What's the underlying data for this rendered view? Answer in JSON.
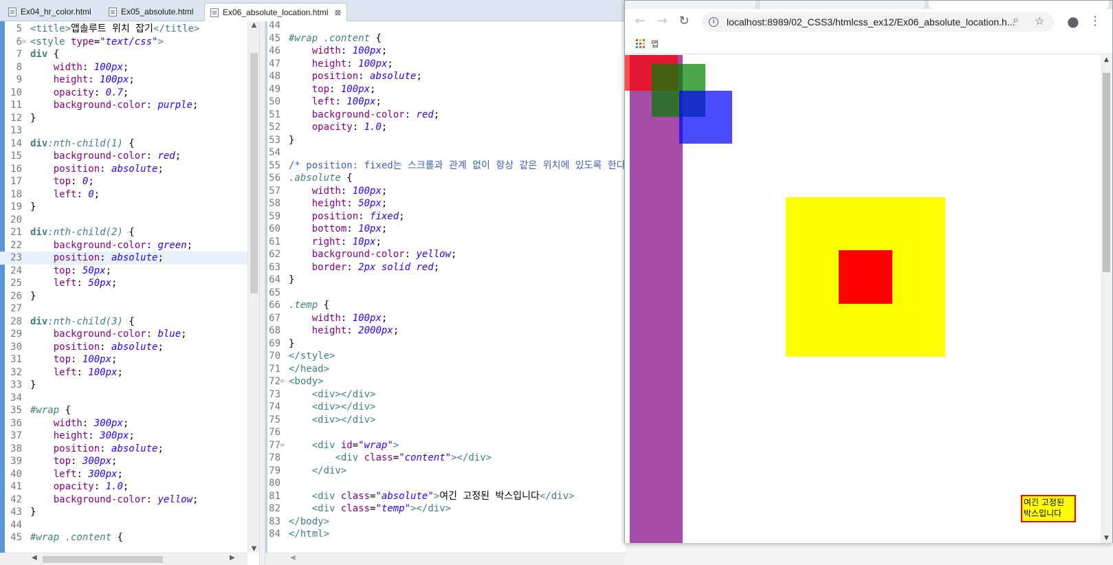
{
  "editor": {
    "tabs": [
      {
        "label": "Ex04_hr_color.html",
        "active": false
      },
      {
        "label": "Ex05_absolute.html",
        "active": false
      },
      {
        "label": "Ex06_absolute_location.html",
        "active": true,
        "close": "⊠"
      }
    ],
    "left_pane": {
      "lines": [
        {
          "n": "5",
          "html": "<span class='t'>&lt;title&gt;</span>앱솔루트 위치 잡기<span class='t'>&lt;/title&gt;</span>"
        },
        {
          "n": "6",
          "fold": true,
          "html": "<span class='t'>&lt;style</span> <span class='a'>type</span>=<span class='v'>\"text/css\"</span><span class='t'>&gt;</span>"
        },
        {
          "n": "7",
          "html": "<span class='k'>div</span> {"
        },
        {
          "n": "8",
          "html": "    <span class='p'>width</span>: <span class='v'>100px</span>;"
        },
        {
          "n": "9",
          "html": "    <span class='p'>height</span>: <span class='v'>100px</span>;"
        },
        {
          "n": "10",
          "html": "    <span class='p'>opacity</span>: <span class='v'>0.7</span>;"
        },
        {
          "n": "11",
          "html": "    <span class='p'>background-color</span>: <span class='v'>purple</span>;"
        },
        {
          "n": "12",
          "html": "}"
        },
        {
          "n": "13",
          "html": ""
        },
        {
          "n": "14",
          "html": "<span class='k'>div</span><span class='i'>:nth-child(1)</span> {"
        },
        {
          "n": "15",
          "html": "    <span class='p'>background-color</span>: <span class='v'>red</span>;"
        },
        {
          "n": "16",
          "html": "    <span class='p'>position</span>: <span class='v'>absolute</span>;"
        },
        {
          "n": "17",
          "html": "    <span class='p'>top</span>: <span class='v'>0</span>;"
        },
        {
          "n": "18",
          "html": "    <span class='p'>left</span>: <span class='v'>0</span>;"
        },
        {
          "n": "19",
          "html": "}"
        },
        {
          "n": "20",
          "html": ""
        },
        {
          "n": "21",
          "html": "<span class='k'>div</span><span class='i'>:nth-child(2)</span> {"
        },
        {
          "n": "22",
          "html": "    <span class='p'>background-color</span>: <span class='v'>green</span>;"
        },
        {
          "n": "23",
          "hl": true,
          "html": "    <span class='p'>position</span>: <span class='v'>absolute</span>;"
        },
        {
          "n": "24",
          "html": "    <span class='p'>top</span>: <span class='v'>50px</span>;"
        },
        {
          "n": "25",
          "html": "    <span class='p'>left</span>: <span class='v'>50px</span>;"
        },
        {
          "n": "26",
          "html": "}"
        },
        {
          "n": "27",
          "html": ""
        },
        {
          "n": "28",
          "html": "<span class='k'>div</span><span class='i'>:nth-child(3)</span> {"
        },
        {
          "n": "29",
          "html": "    <span class='p'>background-color</span>: <span class='v'>blue</span>;"
        },
        {
          "n": "30",
          "html": "    <span class='p'>position</span>: <span class='v'>absolute</span>;"
        },
        {
          "n": "31",
          "html": "    <span class='p'>top</span>: <span class='v'>100px</span>;"
        },
        {
          "n": "32",
          "html": "    <span class='p'>left</span>: <span class='v'>100px</span>;"
        },
        {
          "n": "33",
          "html": "}"
        },
        {
          "n": "34",
          "html": ""
        },
        {
          "n": "35",
          "html": "<span class='i'>#wrap</span> {"
        },
        {
          "n": "36",
          "html": "    <span class='p'>width</span>: <span class='v'>300px</span>;"
        },
        {
          "n": "37",
          "html": "    <span class='p'>height</span>: <span class='v'>300px</span>;"
        },
        {
          "n": "38",
          "html": "    <span class='p'>position</span>: <span class='v'>absolute</span>;"
        },
        {
          "n": "39",
          "html": "    <span class='p'>top</span>: <span class='v'>300px</span>;"
        },
        {
          "n": "40",
          "html": "    <span class='p'>left</span>: <span class='v'>300px</span>;"
        },
        {
          "n": "41",
          "html": "    <span class='p'>opacity</span>: <span class='v'>1.0</span>;"
        },
        {
          "n": "42",
          "html": "    <span class='p'>background-color</span>: <span class='v'>yellow</span>;"
        },
        {
          "n": "43",
          "html": "}"
        },
        {
          "n": "44",
          "html": ""
        },
        {
          "n": "45",
          "html": "<span class='i'>#wrap .content</span> {"
        }
      ]
    },
    "middle_pane": {
      "lines": [
        {
          "n": "44",
          "html": ""
        },
        {
          "n": "45",
          "html": "<span class='i'>#wrap .content</span> {"
        },
        {
          "n": "46",
          "html": "    <span class='p'>width</span>: <span class='v'>100px</span>;"
        },
        {
          "n": "47",
          "html": "    <span class='p'>height</span>: <span class='v'>100px</span>;"
        },
        {
          "n": "48",
          "html": "    <span class='p'>position</span>: <span class='v'>absolute</span>;"
        },
        {
          "n": "49",
          "html": "    <span class='p'>top</span>: <span class='v'>100px</span>;"
        },
        {
          "n": "50",
          "html": "    <span class='p'>left</span>: <span class='v'>100px</span>;"
        },
        {
          "n": "51",
          "html": "    <span class='p'>background-color</span>: <span class='v'>red</span>;"
        },
        {
          "n": "52",
          "html": "    <span class='p'>opacity</span>: <span class='v'>1.0</span>;"
        },
        {
          "n": "53",
          "html": "}"
        },
        {
          "n": "54",
          "html": ""
        },
        {
          "n": "55",
          "html": "<span class='c'>/* position: fixed는 스크롤과 관계 없이 항상 같은 위치에 있도록 한다 */</span>"
        },
        {
          "n": "56",
          "html": "<span class='i'>.absolute</span> {"
        },
        {
          "n": "57",
          "html": "    <span class='p'>width</span>: <span class='v'>100px</span>;"
        },
        {
          "n": "58",
          "html": "    <span class='p'>height</span>: <span class='v'>50px</span>;"
        },
        {
          "n": "59",
          "html": "    <span class='p'>position</span>: <span class='v'>fixed</span>;"
        },
        {
          "n": "60",
          "html": "    <span class='p'>bottom</span>: <span class='v'>10px</span>;"
        },
        {
          "n": "61",
          "html": "    <span class='p'>right</span>: <span class='v'>10px</span>;"
        },
        {
          "n": "62",
          "html": "    <span class='p'>background-color</span>: <span class='v'>yellow</span>;"
        },
        {
          "n": "63",
          "html": "    <span class='p'>border</span>: <span class='v'>2px solid red</span>;"
        },
        {
          "n": "64",
          "html": "}"
        },
        {
          "n": "65",
          "html": ""
        },
        {
          "n": "66",
          "html": "<span class='i'>.temp</span> {"
        },
        {
          "n": "67",
          "html": "    <span class='p'>width</span>: <span class='v'>100px</span>;"
        },
        {
          "n": "68",
          "html": "    <span class='p'>height</span>: <span class='v'>2000px</span>;"
        },
        {
          "n": "69",
          "html": "}"
        },
        {
          "n": "70",
          "html": "<span class='t'>&lt;/style&gt;</span>"
        },
        {
          "n": "71",
          "html": "<span class='t'>&lt;/head&gt;</span>"
        },
        {
          "n": "72",
          "fold": true,
          "html": "<span class='t'>&lt;body&gt;</span>"
        },
        {
          "n": "73",
          "html": "    <span class='t'>&lt;div&gt;&lt;/div&gt;</span>"
        },
        {
          "n": "74",
          "html": "    <span class='t'>&lt;div&gt;&lt;/div&gt;</span>"
        },
        {
          "n": "75",
          "html": "    <span class='t'>&lt;div&gt;&lt;/div&gt;</span>"
        },
        {
          "n": "76",
          "html": ""
        },
        {
          "n": "77",
          "fold": true,
          "html": "    <span class='t'>&lt;div</span> <span class='a'>id</span>=<span class='v'>\"wrap\"</span><span class='t'>&gt;</span>"
        },
        {
          "n": "78",
          "html": "        <span class='t'>&lt;div</span> <span class='a'>class</span>=<span class='v'>\"content\"</span><span class='t'>&gt;&lt;/div&gt;</span>"
        },
        {
          "n": "79",
          "html": "    <span class='t'>&lt;/div&gt;</span>"
        },
        {
          "n": "80",
          "html": ""
        },
        {
          "n": "81",
          "html": "    <span class='t'>&lt;div</span> <span class='a'>class</span>=<span class='v'>\"absolute\"</span><span class='t'>&gt;</span>여긴 고정된 박스입니다<span class='t'>&lt;/div&gt;</span>"
        },
        {
          "n": "82",
          "html": "    <span class='t'>&lt;div</span> <span class='a'>class</span>=<span class='v'>\"temp\"</span><span class='t'>&gt;&lt;/div&gt;</span>"
        },
        {
          "n": "83",
          "html": "<span class='t'>&lt;/body&gt;</span>"
        },
        {
          "n": "84",
          "html": "<span class='t'>&lt;/html&gt;</span>"
        }
      ]
    }
  },
  "browser": {
    "url": "localhost:8989/02_CSS3/htmlcss_ex12/Ex06_absolute_location.h...",
    "bookmark_apps_label": "앱",
    "fixed_box_text": "여긴 고정된 박스입니다",
    "icons": [
      "back-arrow-icon",
      "forward-arrow-icon",
      "reload-icon",
      "info-icon",
      "zoom-icon",
      "star-icon",
      "profile-icon",
      "menu-dots-icon",
      "apps-grid-icon"
    ],
    "colors": {
      "purple": "#800080",
      "red": "#ff0000",
      "green": "#008000",
      "blue": "#0000ff",
      "yellow": "#ffff00"
    }
  }
}
